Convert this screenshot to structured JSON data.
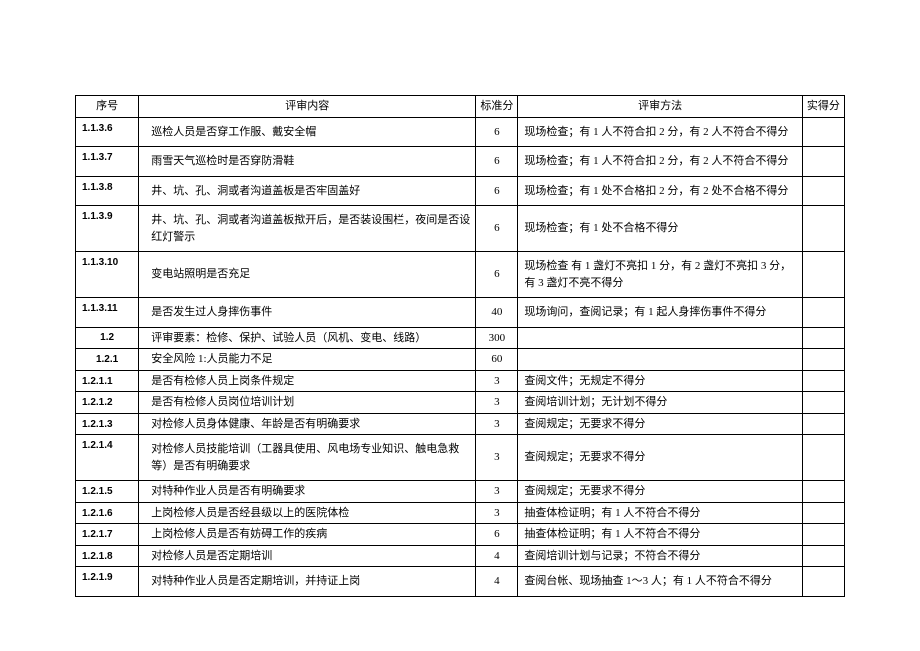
{
  "headers": {
    "num": "序号",
    "content": "评审内容",
    "score": "标准分",
    "method": "评审方法",
    "actual": "实得分"
  },
  "rows": [
    {
      "num": "1.1.3.6",
      "content": "巡检人员是否穿工作服、戴安全帽",
      "score": "6",
      "method": "现场检查；有 1 人不符合扣 2 分，有 2 人不符合不得分",
      "tall": true,
      "methodBottom": true
    },
    {
      "num": "1.1.3.7",
      "content": "雨雪天气巡检时是否穿防滑鞋",
      "score": "6",
      "method": "现场检查；有 1 人不符合扣 2 分，有 2 人不符合不得分",
      "tall": true,
      "methodBottom": true
    },
    {
      "num": "1.1.3.8",
      "content": "井、坑、孔、洞或者沟道盖板是否牢固盖好",
      "score": "6",
      "method": "现场检查；有 1 处不合格扣 2 分，有 2 处不合格不得分",
      "tall": true,
      "methodBottom": true
    },
    {
      "num": "1.1.3.9",
      "content": "井、坑、孔、洞或者沟道盖板揿开后，是否装设围栏，夜间是否设红灯警示",
      "score": "6",
      "method": "现场检查；有 1 处不合格不得分",
      "tall": true
    },
    {
      "num": "1.1.3.10",
      "content": "变电站照明是否充足",
      "score": "6",
      "method": "现场检查 有 1 盏灯不亮扣 1 分，有 2 盏灯不亮扣 3 分，有 3 盏灯不亮不得分",
      "tall": true
    },
    {
      "num": "1.1.3.11",
      "content": "是否发生过人身摔伤事件",
      "score": "40",
      "method": "现场询问，查阅记录；有 1 起人身摔伤事件不得分",
      "tall": true,
      "methodBottom": true
    },
    {
      "num": "1.2",
      "numCenter": true,
      "content": "评审要素：检修、保护、试验人员（风机、变电、线路）",
      "score": "300",
      "method": ""
    },
    {
      "num": "1.2.1",
      "numCenter": true,
      "content": "安全风险 1:人员能力不足",
      "score": "60",
      "method": ""
    },
    {
      "num": "1.2.1.1",
      "content": "是否有检修人员上岗条件规定",
      "score": "3",
      "method": "查阅文件；无规定不得分"
    },
    {
      "num": "1.2.1.2",
      "content": "是否有检修人员岗位培训计划",
      "score": "3",
      "method": "查阅培训计划；无计划不得分"
    },
    {
      "num": "1.2.1.3",
      "content": "对检修人员身体健康、年龄是否有明确要求",
      "score": "3",
      "method": "查阅规定；无要求不得分"
    },
    {
      "num": "1.2.1.4",
      "content": "对检修人员技能培训（工器具使用、风电场专业知识、触电急救等）是否有明确要求",
      "score": "3",
      "method": "查阅规定；无要求不得分",
      "tall": true
    },
    {
      "num": "1.2.1.5",
      "content": "对特种作业人员是否有明确要求",
      "score": "3",
      "method": "查阅规定；无要求不得分"
    },
    {
      "num": "1.2.1.6",
      "content": "上岗检修人员是否经县级以上的医院体检",
      "score": "3",
      "method": "抽查体检证明；有 1 人不符合不得分"
    },
    {
      "num": "1.2.1.7",
      "content": "上岗检修人员是否有妨碍工作的疾病",
      "score": "6",
      "method": "抽查体检证明；有 1 人不符合不得分"
    },
    {
      "num": "1.2.1.8",
      "content": "对检修人员是否定期培训",
      "score": "4",
      "method": "查阅培训计划与记录；不符合不得分"
    },
    {
      "num": "1.2.1.9",
      "content": "对特种作业人员是否定期培训，并持证上岗",
      "score": "4",
      "method": "查阅台帐、现场抽查 1～3 人；有 1 人不符合不得分",
      "tall": true
    }
  ]
}
